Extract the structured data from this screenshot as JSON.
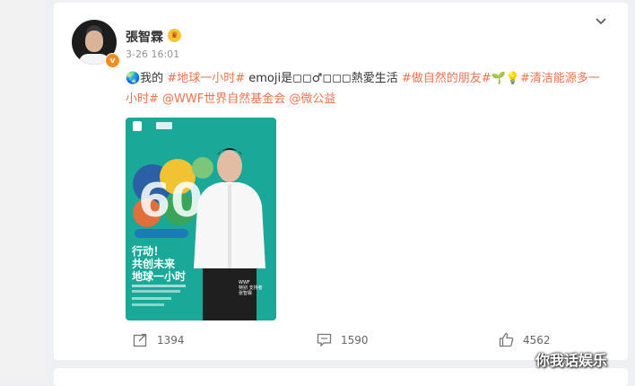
{
  "post": {
    "username": "張智霖",
    "timestamp": "3-26 16:01",
    "verified_badge": "v",
    "text_segments": [
      {
        "text": "🌏我的 ",
        "type": "plain"
      },
      {
        "text": "#地球一小时#",
        "type": "tag"
      },
      {
        "text": " emoji是◻◻♂◻◻◻熱愛生活 ",
        "type": "plain"
      },
      {
        "text": "#做自然的朋友#",
        "type": "tag"
      },
      {
        "text": "🌱💡",
        "type": "plain"
      },
      {
        "text": "#清洁能源多一小时#",
        "type": "tag"
      },
      {
        "text": " ",
        "type": "plain"
      },
      {
        "text": "@WWF世界自然基金会",
        "type": "tag"
      },
      {
        "text": " ",
        "type": "plain"
      },
      {
        "text": "@微公益",
        "type": "tag"
      }
    ],
    "image": {
      "number_art": "60+",
      "headline_lines": [
        "行动！",
        "共创未来",
        "地球一小时"
      ],
      "caption_lines": [
        "WWF",
        "特别 支持者",
        "张智霖"
      ]
    }
  },
  "actions": {
    "repost_count": "1394",
    "comment_count": "1590",
    "like_count": "4562"
  },
  "watermark": "你我话娱乐",
  "colors": {
    "accent": "#eb7350",
    "verified": "#f78b1f",
    "poster_bg": "#1aa898"
  },
  "icons": [
    "chevron-down-icon",
    "crown-icon",
    "repost-icon",
    "comment-icon",
    "like-icon"
  ]
}
